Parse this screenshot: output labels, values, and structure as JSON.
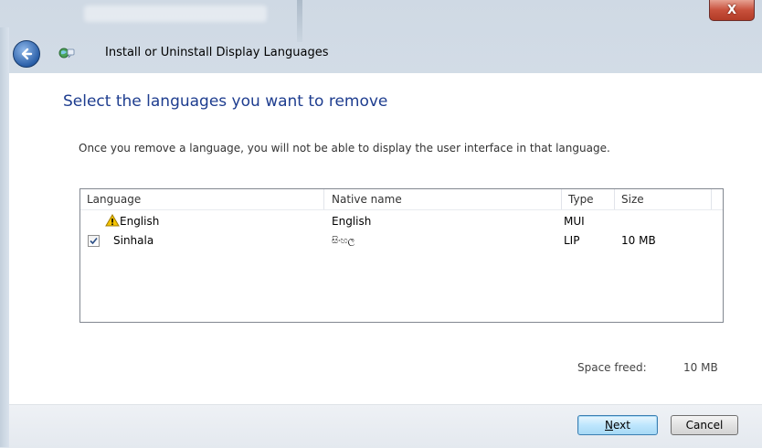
{
  "window": {
    "close_glyph": "X",
    "nav_title": "Install or Uninstall Display Languages"
  },
  "page": {
    "heading": "Select the languages you want to remove",
    "description": "Once you remove a language, you will not be able to display the user interface in that language."
  },
  "list": {
    "headers": {
      "language": "Language",
      "native": "Native name",
      "type": "Type",
      "size": "Size"
    },
    "rows": [
      {
        "checked": null,
        "warning_icon": "warning-icon",
        "language": "English",
        "native": "English",
        "type": "MUI",
        "size": ""
      },
      {
        "checked": true,
        "warning_icon": null,
        "language": "Sinhala",
        "native": "සිංහල",
        "type": "LIP",
        "size": "10 MB"
      }
    ]
  },
  "footer": {
    "space_label": "Space freed:",
    "space_value": "10 MB"
  },
  "buttons": {
    "next_label": "Next",
    "next_accelerator": "N",
    "next_rest": "ext",
    "cancel_label": "Cancel"
  },
  "colors": {
    "heading": "#1e3d8f",
    "close": "#c8513c",
    "default_button": "#bee6fd"
  },
  "icons": {
    "back": "back-arrow-icon",
    "globe": "language-globe-icon",
    "close": "close-icon",
    "warning": "warning-icon",
    "checkbox": "checkmark-icon"
  }
}
